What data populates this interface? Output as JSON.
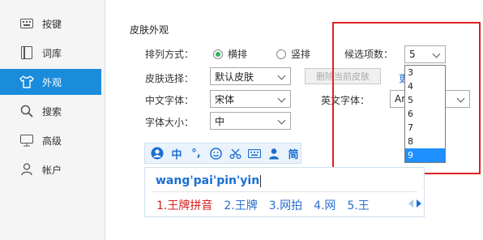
{
  "sidebar": {
    "items": [
      {
        "label": "按键",
        "icon": "keyboard-icon"
      },
      {
        "label": "词库",
        "icon": "dictionary-icon"
      },
      {
        "label": "外观",
        "icon": "shirt-icon",
        "active": true
      },
      {
        "label": "搜索",
        "icon": "search-icon"
      },
      {
        "label": "高级",
        "icon": "monitor-icon"
      },
      {
        "label": "帐户",
        "icon": "user-icon"
      }
    ]
  },
  "skin": {
    "section_title": "皮肤外观",
    "layout_label": "排列方式：",
    "layout_horizontal": "横排",
    "layout_vertical": "竖排",
    "candidates_label": "候选项数：",
    "candidates_value": "5",
    "candidates_options": [
      "3",
      "4",
      "5",
      "6",
      "7",
      "8",
      "9"
    ],
    "candidates_highlighted": "9",
    "skin_label": "皮肤选择：",
    "skin_value": "默认皮肤",
    "delete_skin_button": "删除当前皮肤",
    "blue_link_fragment": "更",
    "cn_font_label": "中文字体：",
    "cn_font_value": "宋体",
    "en_font_label": "英文字体：",
    "en_font_value": "Ar",
    "font_size_label": "字体大小：",
    "font_size_value": "中"
  },
  "ime_preview": {
    "toolbar_icons": [
      "sogou-logo-icon",
      "chinese-mode-icon",
      "punctuation-icon",
      "emoji-icon",
      "scissors-icon",
      "keyboard-icon",
      "user-icon",
      "simplified-icon"
    ],
    "toolbar_text": {
      "chinese_mode": "中",
      "punctuation": "°,",
      "simplified": "简"
    },
    "pinyin": "wang'pai'pin'yin",
    "candidates": [
      "1.王牌拼音",
      "2.王牌",
      "3.网拍",
      "4.网",
      "5.王"
    ]
  },
  "colors": {
    "accent": "#1a8cdb",
    "highlight_border": "#e02020",
    "first_candidate": "#d42020",
    "candidate": "#2a6fcf",
    "radio_on": "#2db35b"
  }
}
